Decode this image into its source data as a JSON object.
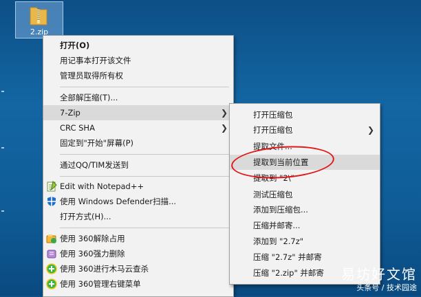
{
  "desktop": {
    "file_name": "2.zip"
  },
  "context_menu": {
    "items": [
      {
        "label": "打开(O)"
      },
      {
        "label": "用记事本打开该文件"
      },
      {
        "label": "管理员取得所有权"
      },
      {
        "label": "全部解压缩(T)..."
      },
      {
        "label": "7-Zip"
      },
      {
        "label": "CRC SHA"
      },
      {
        "label": "固定到\"开始\"屏幕(P)"
      },
      {
        "label": "通过QQ/TIM发送到"
      },
      {
        "label": "Edit with Notepad++"
      },
      {
        "label": "使用 Windows Defender扫描..."
      },
      {
        "label": "打开方式(H)..."
      },
      {
        "label": "使用 360解除占用"
      },
      {
        "label": "使用 360强力删除"
      },
      {
        "label": "使用 360进行木马云查杀"
      },
      {
        "label": "使用 360管理右键菜单"
      }
    ]
  },
  "submenu_7zip": {
    "items": [
      {
        "label": "打开压缩包"
      },
      {
        "label": "打开压缩包"
      },
      {
        "label": "提取文件..."
      },
      {
        "label": "提取到当前位置"
      },
      {
        "label": "提取到 \"2\\\""
      },
      {
        "label": "测试压缩包"
      },
      {
        "label": "添加到压缩包..."
      },
      {
        "label": "压缩并邮寄..."
      },
      {
        "label": "添加到 \"2.7z\""
      },
      {
        "label": "压缩 \"2.7z\" 并邮寄"
      },
      {
        "label": "压缩 \"2.zip\" 并邮寄"
      }
    ]
  },
  "watermark": {
    "line1": "易坊好文馆",
    "line2": "头条号 / 技术园途"
  },
  "colors": {
    "highlight": "#dadada",
    "annotation": "#e01818"
  }
}
